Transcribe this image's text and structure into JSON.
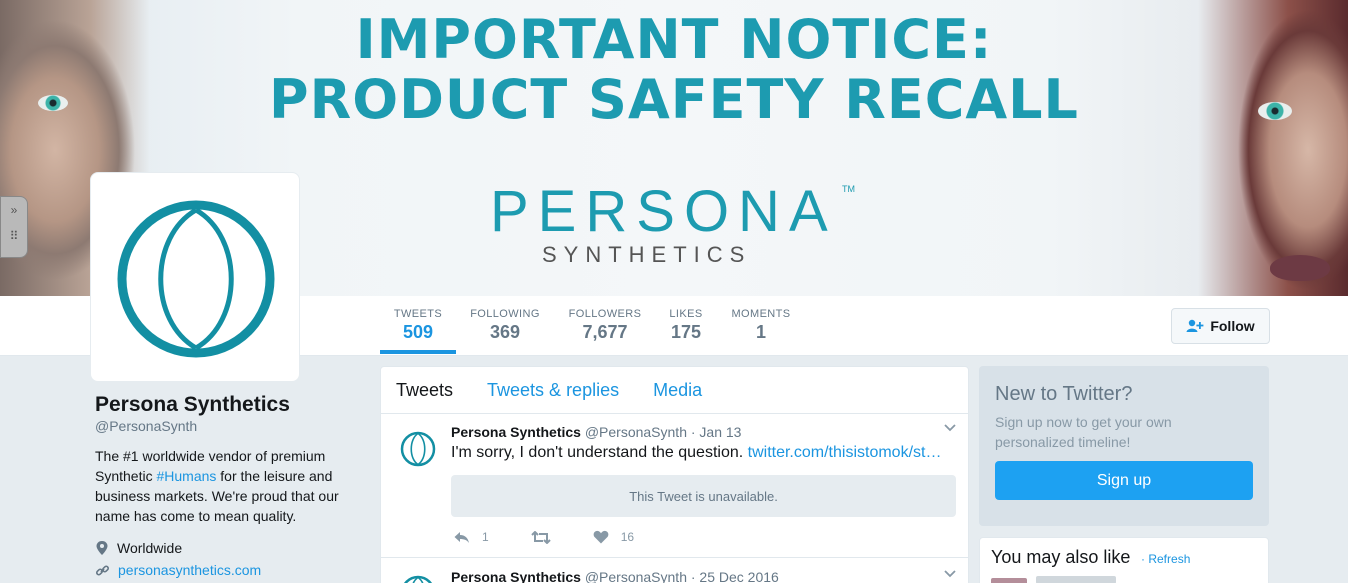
{
  "banner": {
    "line1": "IMPORTANT NOTICE:",
    "line2": "PRODUCT SAFETY RECALL",
    "brand_word": "PERSONA",
    "brand_tm": "TM",
    "brand_sub": "SYNTHETICS"
  },
  "side_handle": {
    "top_glyph": "»",
    "bottom_glyph": "⠿"
  },
  "stats": [
    {
      "label": "TWEETS",
      "value": "509"
    },
    {
      "label": "FOLLOWING",
      "value": "369"
    },
    {
      "label": "FOLLOWERS",
      "value": "7,677"
    },
    {
      "label": "LIKES",
      "value": "175"
    },
    {
      "label": "MOMENTS",
      "value": "1"
    }
  ],
  "follow_label": "Follow",
  "profile": {
    "name": "Persona Synthetics",
    "handle": "@PersonaSynth",
    "bio_before": "The #1 worldwide vendor of premium Synthetic ",
    "bio_hashtag": "#Humans",
    "bio_after": " for the leisure and business markets. We're proud that our name has come to mean quality.",
    "location": "Worldwide",
    "website": "personasynthetics.com"
  },
  "tabs": [
    "Tweets",
    "Tweets & replies",
    "Media"
  ],
  "tweets": [
    {
      "name": "Persona Synthetics",
      "handle": "@PersonaSynth",
      "date": "· Jan 13",
      "text": "I'm sorry, I don't understand the question. ",
      "link": "twitter.com/thisistomok/st…",
      "unavailable": "This Tweet is unavailable.",
      "replies": "1",
      "likes": "16"
    },
    {
      "name": "Persona Synthetics",
      "handle": "@PersonaSynth",
      "date": "· 25 Dec 2016"
    }
  ],
  "signup": {
    "title": "New to Twitter?",
    "subtitle": "Sign up now to get your own personalized timeline!",
    "button": "Sign up"
  },
  "wtf": {
    "title": "You may also like",
    "separator": "·",
    "refresh": "Refresh"
  },
  "colors": {
    "accent": "#1b95e0",
    "brand": "#1d9bb0",
    "signup_button": "#1da1f2"
  }
}
